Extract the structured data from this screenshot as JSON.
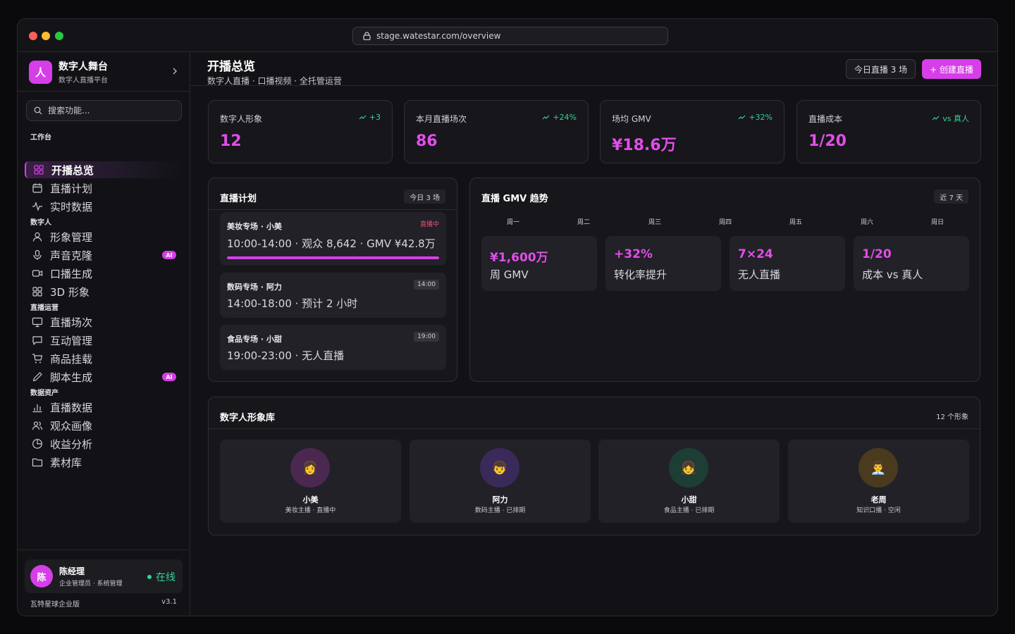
{
  "browser": {
    "url": "stage.watestar.com/overview"
  },
  "brand": {
    "logo_letter": "人",
    "name": "数字人舞台",
    "subtitle": "数字人直播平台"
  },
  "search": {
    "placeholder": "搜索功能..."
  },
  "sections": [
    {
      "label": "工作台",
      "items": [
        {
          "label": "开播总览",
          "icon": "grid-icon",
          "active": true
        },
        {
          "label": "直播计划",
          "icon": "calendar-icon"
        },
        {
          "label": "实时数据",
          "icon": "pulse-icon"
        }
      ]
    },
    {
      "label": "数字人",
      "items": [
        {
          "label": "形象管理",
          "icon": "user-icon"
        },
        {
          "label": "声音克隆",
          "icon": "mic-icon",
          "badge": "AI"
        },
        {
          "label": "口播生成",
          "icon": "video-icon"
        },
        {
          "label": "3D 形象",
          "icon": "grid-icon"
        }
      ]
    },
    {
      "label": "直播运营",
      "items": [
        {
          "label": "直播场次",
          "icon": "monitor-icon"
        },
        {
          "label": "互动管理",
          "icon": "chat-icon"
        },
        {
          "label": "商品挂载",
          "icon": "cart-icon"
        },
        {
          "label": "脚本生成",
          "icon": "pen-icon",
          "badge": "AI"
        }
      ]
    },
    {
      "label": "数据资产",
      "items": [
        {
          "label": "直播数据",
          "icon": "bar-chart-icon"
        },
        {
          "label": "观众画像",
          "icon": "users-icon"
        },
        {
          "label": "收益分析",
          "icon": "pie-icon"
        },
        {
          "label": "素材库",
          "icon": "folder-icon"
        }
      ]
    }
  ],
  "user": {
    "avatar_letter": "陈",
    "name": "陈经理",
    "role": "企业管理员 · 系统管理",
    "status": "在线"
  },
  "footer": {
    "edition": "瓦特星球企业版",
    "version": "v3.1"
  },
  "header": {
    "title": "开播总览",
    "subtitle": "数字人直播 · 口播视频 · 全托管运营",
    "today_button": "今日直播 3 场",
    "create_button": "+ 创建直播"
  },
  "stats": [
    {
      "label": "数字人形象",
      "delta": "+3",
      "value": "12"
    },
    {
      "label": "本月直播场次",
      "delta": "+24%",
      "value": "86"
    },
    {
      "label": "场均 GMV",
      "delta": "+32%",
      "value": "¥18.6万"
    },
    {
      "label": "直播成本",
      "delta": "vs 真人",
      "value": "1/20"
    }
  ],
  "schedule": {
    "title": "直播计划",
    "tag": "今日 3 场",
    "items": [
      {
        "name": "美妆专场 · 小美",
        "tag": "直播中",
        "detail": "10:00-14:00 · 观众 8,642 · GMV ¥42.8万",
        "progress": 1.0
      },
      {
        "name": "数码专场 · 阿力",
        "tag": "14:00",
        "detail": "14:00-18:00 · 预计 2 小时"
      },
      {
        "name": "食品专场 · 小甜",
        "tag": "19:00",
        "detail": "19:00-23:00 · 无人直播"
      }
    ]
  },
  "trend": {
    "title": "直播 GMV 趋势",
    "tag": "近 7 天",
    "days": [
      "周一",
      "周二",
      "周三",
      "周四",
      "周五",
      "周六",
      "周日"
    ],
    "kpis": [
      {
        "value": "¥1,600万",
        "label": "周 GMV"
      },
      {
        "value": "+32%",
        "label": "转化率提升"
      },
      {
        "value": "7×24",
        "label": "无人直播"
      },
      {
        "value": "1/20",
        "label": "成本 vs 真人"
      }
    ]
  },
  "library": {
    "title": "数字人形象库",
    "tag": "12 个形象",
    "avatars": [
      {
        "name": "小美",
        "status": "美妆主播 · 直播中",
        "emoji": "👩",
        "bg": "#4a2850"
      },
      {
        "name": "阿力",
        "status": "数码主播 · 已排期",
        "emoji": "👦",
        "bg": "#3a2a5a"
      },
      {
        "name": "小甜",
        "status": "食品主播 · 已排期",
        "emoji": "👧",
        "bg": "#1e3d34"
      },
      {
        "name": "老周",
        "status": "知识口播 · 空闲",
        "emoji": "👨‍💼",
        "bg": "#4a3a1e"
      }
    ]
  },
  "colors": {
    "accent": "#d63ee8",
    "positive": "#34d399",
    "live": "#f0506e"
  }
}
